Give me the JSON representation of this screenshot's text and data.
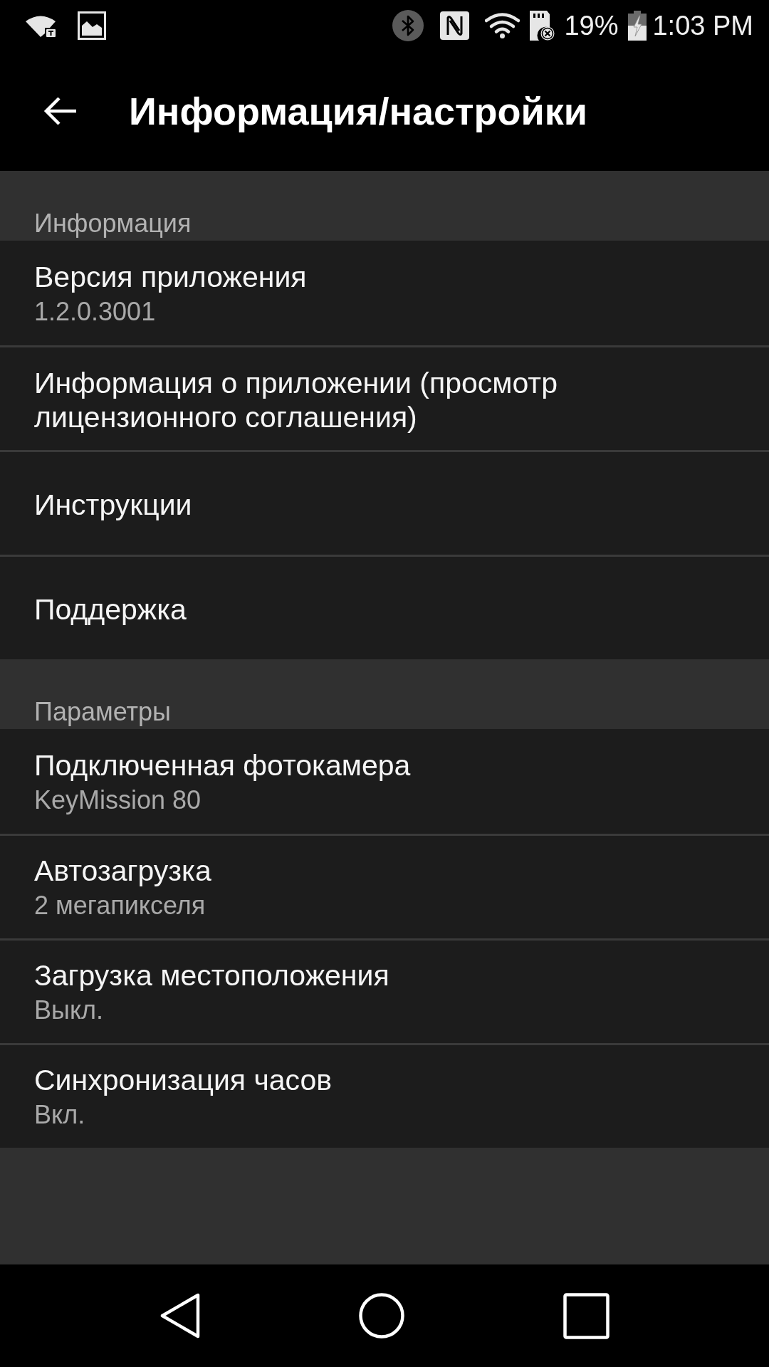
{
  "status_bar": {
    "battery_text": "19%",
    "time": "1:03 PM"
  },
  "app_bar": {
    "title": "Информация/настройки"
  },
  "sections": [
    {
      "header": "Информация",
      "items": [
        {
          "title": "Версия приложения",
          "value": "1.2.0.3001"
        },
        {
          "title": "Информация о приложении (просмотр лицензионного соглашения)"
        },
        {
          "title": "Инструкции"
        },
        {
          "title": "Поддержка"
        }
      ]
    },
    {
      "header": "Параметры",
      "items": [
        {
          "title": "Подключенная фотокамера",
          "value": "KeyMission 80"
        },
        {
          "title": "Автозагрузка",
          "value": "2 мегапикселя"
        },
        {
          "title": "Загрузка местоположения",
          "value": "Выкл."
        },
        {
          "title": "Синхронизация часов",
          "value": "Вкл."
        }
      ]
    }
  ]
}
